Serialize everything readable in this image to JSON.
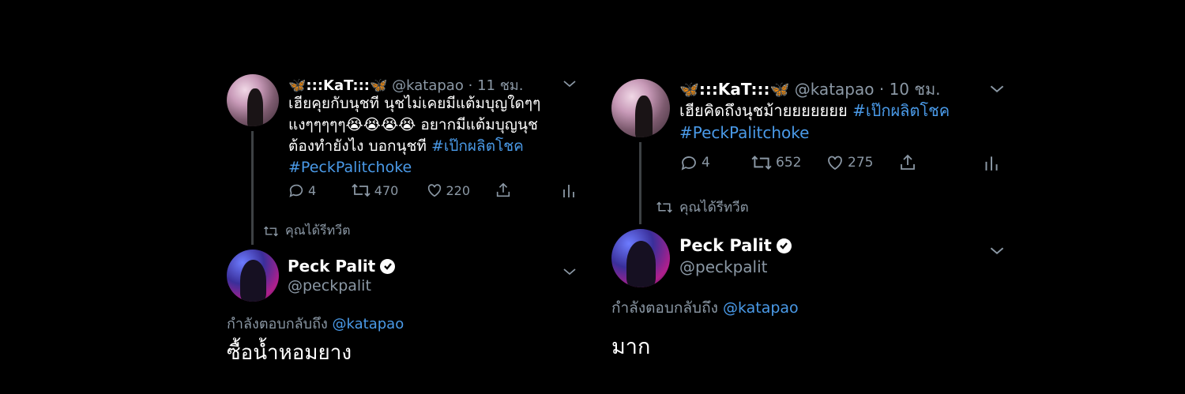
{
  "left_panel": {
    "original": {
      "display_name": ":::KaT:::",
      "emoji_icon": "butterfly",
      "handle": "@katapao",
      "time": "11 ชม.",
      "text_line1": "เฮียคุยกับนุชที นุชไม่เคยมีแต้มบุญใดๆๆ",
      "text_line2": "แงๆๆๆๆๆ😭😭😭😭  อยากมีแต้มบุญนุช",
      "text_line3": "ต้องทำยังไง บอกนุชที ",
      "hashtag1": "#เป๊กผลิตโชค",
      "hashtag2": "#PeckPalitchoke",
      "replies": "4",
      "retweets": "470",
      "likes": "220"
    },
    "retweeted_label": "คุณได้รีทวีต",
    "reply": {
      "display_name": "Peck Palit",
      "handle": "@peckpalit",
      "replying_to_label": "กำลังตอบกลับถึง",
      "replying_to_handle": "@katapao",
      "text": "ซื้อน้ำหอมยาง"
    }
  },
  "right_panel": {
    "original": {
      "display_name": ":::KaT:::",
      "emoji_icon": "butterfly",
      "handle": "@katapao",
      "time": "10 ชม.",
      "text_line1": "เฮียคิดถึงนุชม้ายยยยยยย ",
      "hashtag1": "#เป๊กผลิตโชค",
      "hashtag2": "#PeckPalitchoke",
      "replies": "4",
      "retweets": "652",
      "likes": "275"
    },
    "retweeted_label": "คุณได้รีทวีต",
    "reply": {
      "display_name": "Peck Palit",
      "handle": "@peckpalit",
      "replying_to_label": "กำลังตอบกลับถึง",
      "replying_to_handle": "@katapao",
      "text": "มาก"
    }
  },
  "colors": {
    "background": "#000000",
    "link": "#4a9ae8",
    "secondary_text": "#8b98a5",
    "primary_text": "#ffffff",
    "butterfly": "#3a8ee6"
  }
}
